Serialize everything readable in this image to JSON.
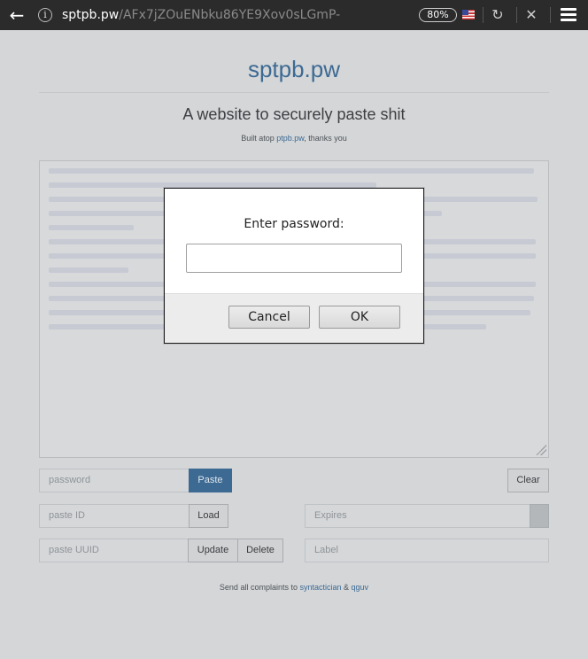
{
  "browser": {
    "url_host": "sptpb.pw",
    "url_path": "/AFx7jZOuENbku86YE9Xov0sLGmP-",
    "zoom": "80%",
    "icons": [
      "back-arrow-icon",
      "info-icon",
      "us-flag-icon",
      "reload-icon",
      "close-icon",
      "menu-icon"
    ]
  },
  "header": {
    "site_title": "sptpb.pw",
    "tagline": "A website to securely paste shit",
    "built_prefix": "Built atop ",
    "built_link": "ptpb.pw",
    "built_suffix": ", thanks you"
  },
  "form": {
    "password_placeholder": "password",
    "paste_button": "Paste",
    "clear_button": "Clear",
    "paste_id_placeholder": "paste ID",
    "load_button": "Load",
    "expires_placeholder": "Expires",
    "paste_uuid_placeholder": "paste UUID",
    "update_button": "Update",
    "delete_button": "Delete",
    "label_placeholder": "Label"
  },
  "footer": {
    "prefix": "Send all complaints to ",
    "link1": "syntactician",
    "amp": " & ",
    "link2": "qguv"
  },
  "dialog": {
    "prompt": "Enter password:",
    "input_value": "",
    "cancel_button": "Cancel",
    "ok_button": "OK"
  },
  "colors": {
    "accent": "#3d6a93",
    "chrome": "#2b2b2b",
    "overlay_bg": "#d4d6d8"
  }
}
